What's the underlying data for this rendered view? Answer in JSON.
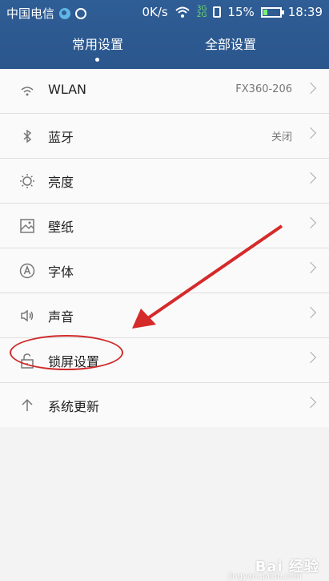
{
  "status": {
    "carrier": "中国电信",
    "speed": "0K/s",
    "signal_top": "3G",
    "signal_bottom": "2G",
    "battery": "15%",
    "time": "18:39"
  },
  "tabs": [
    {
      "label": "常用设置"
    },
    {
      "label": "全部设置"
    }
  ],
  "items": [
    {
      "label": "WLAN",
      "value": "FX360-206",
      "icon": "wifi-icon"
    },
    {
      "label": "蓝牙",
      "value": "关闭",
      "icon": "bluetooth-icon"
    },
    {
      "label": "亮度",
      "value": "",
      "icon": "brightness-icon"
    },
    {
      "label": "壁纸",
      "value": "",
      "icon": "wallpaper-icon"
    },
    {
      "label": "字体",
      "value": "",
      "icon": "font-icon"
    },
    {
      "label": "声音",
      "value": "",
      "icon": "sound-icon"
    },
    {
      "label": "锁屏设置",
      "value": "",
      "icon": "lock-icon"
    },
    {
      "label": "系统更新",
      "value": "",
      "icon": "update-arrow-icon"
    }
  ],
  "watermark": {
    "text": "Bai 经验",
    "sub": "jingyan.baidu.com"
  },
  "colors": {
    "header": "#2f5d95",
    "annotation": "#d02b2b"
  }
}
